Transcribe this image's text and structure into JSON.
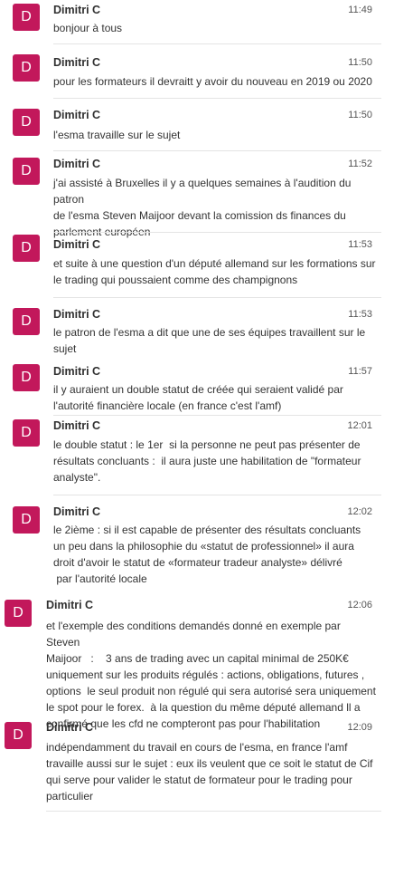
{
  "messages": [
    {
      "initial": "D",
      "author": "Dimitri C",
      "time": "11:49",
      "text": "bonjour à tous"
    },
    {
      "initial": "D",
      "author": "Dimitri C",
      "time": "11:50",
      "text": "pour les formateurs il devraitt y avoir du nouveau en 2019 ou 2020"
    },
    {
      "initial": "D",
      "author": "Dimitri C",
      "time": "11:50",
      "text": "l'esma travaille sur le sujet"
    },
    {
      "initial": "D",
      "author": "Dimitri C",
      "time": "11:52",
      "text": "j'ai assisté à Bruxelles il y a quelques semaines à l'audition du patron\nde l'esma Steven Maijoor devant la comission ds finances du\nparlement européen"
    },
    {
      "initial": "D",
      "author": "Dimitri C",
      "time": "11:53",
      "text": "et suite à une question d'un député allemand sur les formations sur\nle trading qui poussaient comme des champignons"
    },
    {
      "initial": "D",
      "author": "Dimitri C",
      "time": "11:53",
      "text": "le patron de l'esma a dit que une de ses équipes travaillent sur le\nsujet"
    },
    {
      "initial": "D",
      "author": "Dimitri C",
      "time": "11:57",
      "text": "il y auraient un double statut de créée qui seraient validé par\nl'autorité financière locale (en france c'est l'amf)"
    },
    {
      "initial": "D",
      "author": "Dimitri C",
      "time": "12:01",
      "text": "le double statut : le 1er  si la personne ne peut pas présenter de\nrésultats concluants :  il aura juste une habilitation de \"formateur\nanalyste\"."
    },
    {
      "initial": "D",
      "author": "Dimitri C",
      "time": "12:02",
      "text": "le 2ième : si il est capable de présenter des résultats concluants\nun peu dans la philosophie du «statut de professionnel» il aura\ndroit d'avoir le statut de «formateur tradeur analyste» délivré\n par l'autorité locale"
    },
    {
      "initial": "D",
      "author": "Dimitri C",
      "time": "12:06",
      "text": "et l'exemple des conditions demandés donné en exemple par Steven\nMaijoor   :    3 ans de trading avec un capital minimal de 250K€\nuniquement sur les produits régulés : actions, obligations, futures ,\noptions  le seul produit non régulé qui sera autorisé sera uniquement\nle spot pour le forex.  à la question du même député allemand ll a\nconfirmé que les cfd ne compteront pas pour l'habilitation"
    },
    {
      "initial": "D",
      "author": "Dimitri C",
      "time": "12:09",
      "text": "indépendamment du travail en cours de l'esma, en france l'amf\ntravaille aussi sur le sujet : eux ils veulent que ce soit le statut de Cif\nqui serve pour valider le statut de formateur pour le trading pour\nparticulier"
    }
  ]
}
